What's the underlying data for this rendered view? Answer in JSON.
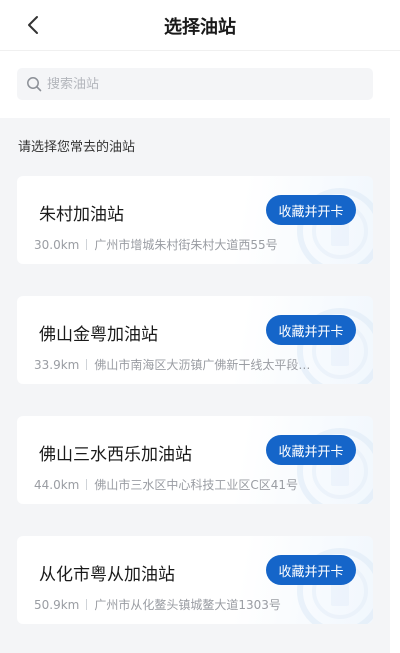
{
  "header": {
    "title": "选择油站"
  },
  "search": {
    "placeholder": "搜索油站"
  },
  "section": {
    "title": "请选择您常去的油站"
  },
  "colors": {
    "accent": "#1565c9",
    "background": "#f4f5f7"
  },
  "icons": {
    "back": "chevron-left-icon",
    "search": "search-icon"
  },
  "stations": [
    {
      "name": "朱村加油站",
      "distance": "30.0km",
      "address": "广州市增城朱村街朱村大道西55号",
      "action": "收藏并开卡"
    },
    {
      "name": "佛山金粤加油站",
      "distance": "33.9km",
      "address": "佛山市南海区大沥镇广佛新干线太平段…",
      "action": "收藏并开卡"
    },
    {
      "name": "佛山三水西乐加油站",
      "distance": "44.0km",
      "address": "佛山市三水区中心科技工业区C区41号",
      "action": "收藏并开卡"
    },
    {
      "name": "从化市粤从加油站",
      "distance": "50.9km",
      "address": "广州市从化鳌头镇城鳌大道1303号",
      "action": "收藏并开卡"
    }
  ]
}
